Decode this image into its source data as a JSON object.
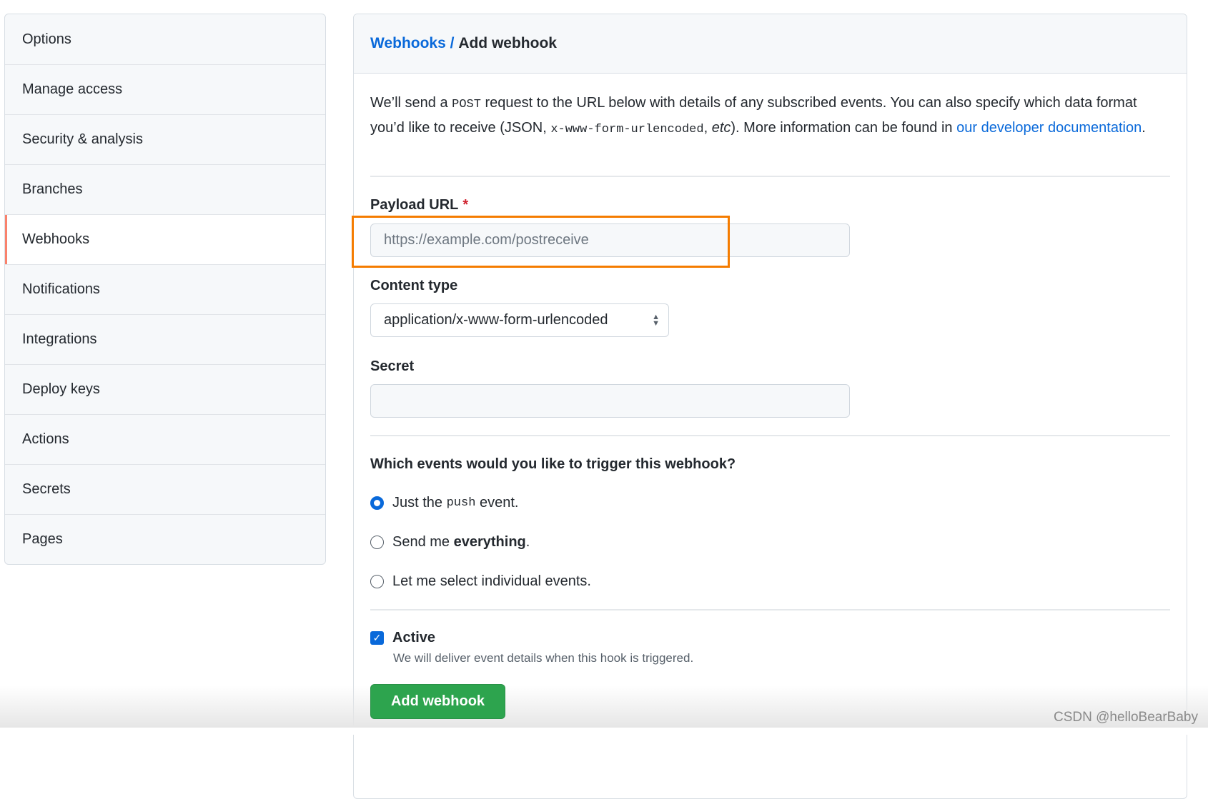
{
  "sidebar": {
    "items": [
      {
        "label": "Options"
      },
      {
        "label": "Manage access"
      },
      {
        "label": "Security & analysis"
      },
      {
        "label": "Branches"
      },
      {
        "label": "Webhooks",
        "active": true
      },
      {
        "label": "Notifications"
      },
      {
        "label": "Integrations"
      },
      {
        "label": "Deploy keys"
      },
      {
        "label": "Actions"
      },
      {
        "label": "Secrets"
      },
      {
        "label": "Pages"
      }
    ]
  },
  "header": {
    "breadcrumb_link": "Webhooks /",
    "title": "Add webhook"
  },
  "description": {
    "p1": "We’ll send a ",
    "code1": "POST",
    "p2": " request to the URL below with details of any subscribed events. You can also specify which data format you’d like to receive (JSON, ",
    "code2": "x-www-form-urlencoded",
    "p3": ", ",
    "em": "etc",
    "p4": "). More information can be found in ",
    "link": "our developer documentation",
    "p5": "."
  },
  "form": {
    "payload_label": "Payload URL",
    "required_mark": "*",
    "payload_placeholder": "https://example.com/postreceive",
    "content_type_label": "Content type",
    "content_type_value": "application/x-www-form-urlencoded",
    "secret_label": "Secret",
    "secret_value": "",
    "events_question": "Which events would you like to trigger this webhook?",
    "events": [
      {
        "pre": "Just the ",
        "code": "push",
        "post": " event.",
        "selected": true
      },
      {
        "pre": "Send me ",
        "bold": "everything",
        "post": ".",
        "selected": false
      },
      {
        "label": "Let me select individual events.",
        "selected": false
      }
    ],
    "active_label": "Active",
    "active_checked": true,
    "active_note": "We will deliver event details when this hook is triggered.",
    "submit": "Add webhook"
  },
  "colors": {
    "accent": "#0969da",
    "highlight": "#f57c00",
    "button": "#2da44e",
    "active_marker": "#f9826c"
  },
  "watermark": "CSDN @helloBearBaby"
}
